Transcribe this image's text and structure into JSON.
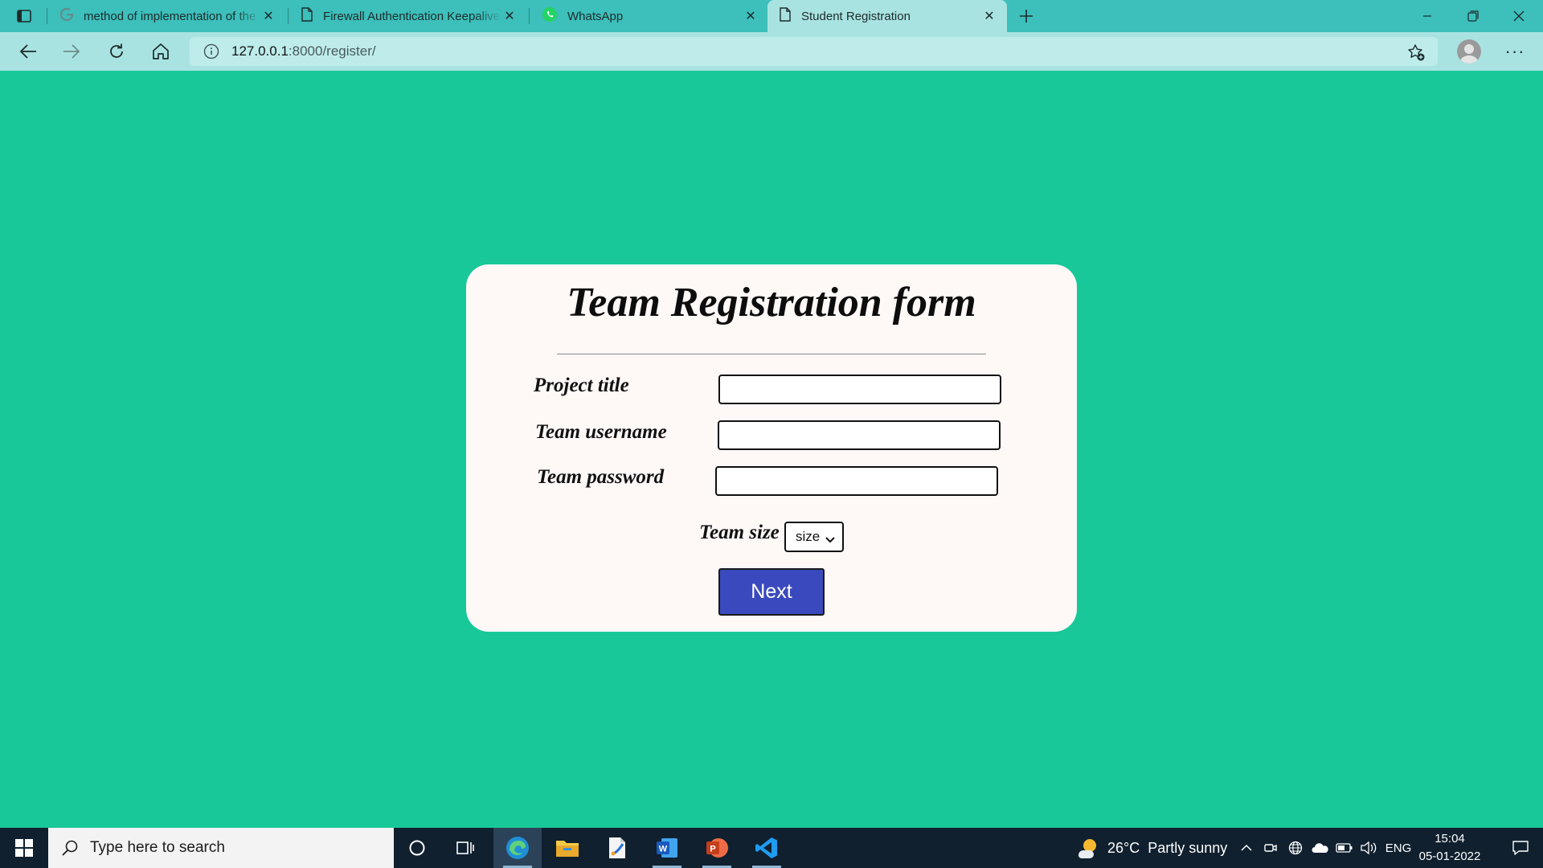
{
  "browser": {
    "tabs": [
      {
        "title": "method of implementation of the",
        "icon": "google-icon",
        "active": false
      },
      {
        "title": "Firewall Authentication Keepalive",
        "icon": "page-icon",
        "active": false
      },
      {
        "title": "WhatsApp",
        "icon": "whatsapp-icon",
        "active": false
      },
      {
        "title": "Student Registration",
        "icon": "page-icon",
        "active": true
      }
    ],
    "address": {
      "host": "127.0.0.1",
      "path": ":8000/register/"
    }
  },
  "form": {
    "title": "Team Registration form",
    "fields": [
      {
        "label": "Project title",
        "value": ""
      },
      {
        "label": "Team username",
        "value": ""
      },
      {
        "label": "Team password",
        "value": ""
      }
    ],
    "team_size_label": "Team size",
    "team_size_selected": "size",
    "submit_label": "Next"
  },
  "taskbar": {
    "search_placeholder": "Type here to search",
    "weather": {
      "temp": "26°C",
      "condition": "Partly sunny"
    },
    "language": "ENG",
    "time": "15:04",
    "date": "05-01-2022"
  },
  "colors": {
    "page_background": "#18c899",
    "tabstrip": "#3dbfbb",
    "toolbar": "#a9e3e1",
    "card": "#fef8f7",
    "button": "#3a4abe",
    "taskbar": "#10202f"
  }
}
